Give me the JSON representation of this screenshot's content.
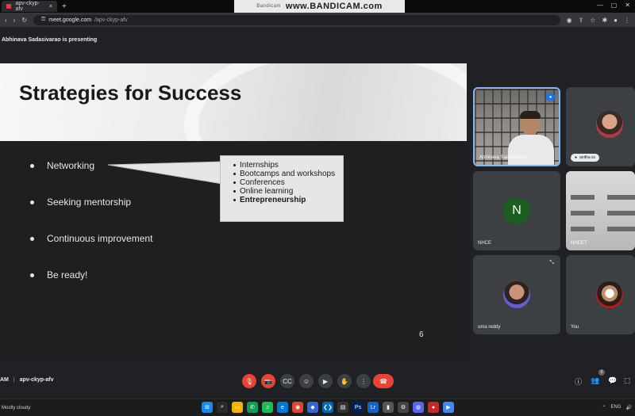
{
  "browser": {
    "tab_title": "apv-ckyp-afv",
    "tab_close": "×",
    "new_tab": "+",
    "url_host": "meet.google.com",
    "url_path": "/apv-ckyp-afv",
    "nav_back": "‹",
    "nav_forward": "›",
    "nav_reload": "↻",
    "lock": "⚿",
    "win_minimize": "—",
    "win_maximize": "▢",
    "win_close": "✕"
  },
  "recorder_watermark": {
    "small": "Bandicam",
    "text": "www.BANDICAM.com"
  },
  "meet": {
    "presenting_text": "Abhinava Sadasivarao is presenting",
    "meeting_code": "apv-ckyp-afv",
    "meeting_time": "AM",
    "people_count": "9"
  },
  "slide": {
    "title": "Strategies for Success",
    "bullets": [
      "Networking",
      "Seeking mentorship",
      "Continuous improvement",
      "Be ready!"
    ],
    "callout_items": [
      "Internships",
      "Bootcamps and workshops",
      "Conferences",
      "Online learning",
      "Entrepreneurship"
    ],
    "page_number": "6"
  },
  "participants": [
    {
      "name": "Abhinava Sadasivarao",
      "type": "video"
    },
    {
      "name": "anitha ss",
      "type": "photo"
    },
    {
      "name": "NHCE",
      "type": "letter",
      "initial": "N",
      "color": "#1b5e20"
    },
    {
      "name": "NHCET",
      "type": "video"
    },
    {
      "name": "uma reddy",
      "type": "photo"
    },
    {
      "name": "You",
      "type": "photo"
    }
  ],
  "controls": {
    "mic": "🎙",
    "camera": "📷",
    "captions": "CC",
    "emoji": "☺",
    "present": "▶",
    "raise_hand": "✋",
    "more": "⋮",
    "leave": "☎",
    "info": "ⓘ",
    "people": "👥",
    "chat": "💬",
    "activities": "⬚"
  },
  "taskbar": {
    "weather": "Mostly cloudy",
    "tray": [
      "ENG",
      "⌃",
      "🔊"
    ]
  },
  "colors": {
    "accent_blue": "#1a73e8",
    "leave_red": "#ea4335",
    "tile_bg": "#3c4043"
  }
}
